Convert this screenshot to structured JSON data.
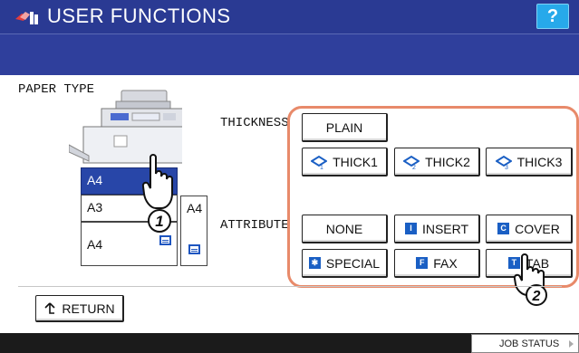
{
  "header": {
    "title": "USER FUNCTIONS",
    "help_label": "?"
  },
  "section": {
    "paper_type": "PAPER TYPE",
    "thickness": "THICKNESS",
    "attribute": "ATTRIBUTE"
  },
  "trays": [
    {
      "label": "A4",
      "selected": true
    },
    {
      "label": "A3"
    },
    {
      "label": "A4"
    },
    {
      "label": "A4",
      "side": true
    }
  ],
  "thickness_buttons": {
    "plain": "PLAIN",
    "thick1": {
      "label": "THICK1",
      "num": "1"
    },
    "thick2": {
      "label": "THICK2",
      "num": "2"
    },
    "thick3": {
      "label": "THICK3",
      "num": "3"
    }
  },
  "attribute_buttons": {
    "none": "NONE",
    "insert": {
      "label": "INSERT",
      "glyph": "I"
    },
    "cover": {
      "label": "COVER",
      "glyph": "C"
    },
    "special": {
      "label": "SPECIAL",
      "glyph": "✱"
    },
    "fax": {
      "label": "FAX",
      "glyph": "F"
    },
    "tab": {
      "label": "TAB",
      "glyph": "T"
    }
  },
  "callouts": {
    "step1": "1",
    "step2": "2"
  },
  "footer": {
    "return_label": "RETURN",
    "job_status": "JOB STATUS"
  },
  "colors": {
    "title_bar": "#2a3a93",
    "help": "#27a9ea",
    "highlight": "#e88a6a",
    "icon_blue": "#1a5fc4"
  },
  "icons": [
    "user-functions-icon",
    "help-icon",
    "return-arrow-icon",
    "tray-icon",
    "paper-thickness-icon",
    "hand-pointer-icon"
  ]
}
